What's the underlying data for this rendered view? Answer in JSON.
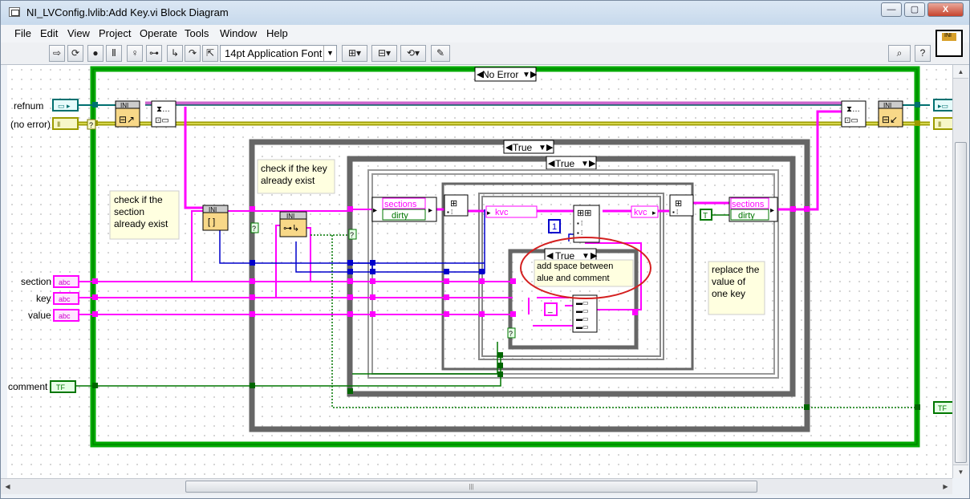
{
  "window": {
    "title": "NI_LVConfig.lvlib:Add Key.vi Block Diagram",
    "controls": {
      "minimize": "—",
      "maximize": "▢",
      "close": "X"
    }
  },
  "menubar": {
    "items": [
      "File",
      "Edit",
      "View",
      "Project",
      "Operate",
      "Tools",
      "Window",
      "Help"
    ]
  },
  "toolbar": {
    "font_select": "14pt Application Font",
    "buttons": [
      "run-arrow-icon",
      "run-continuously-icon",
      "abort-icon",
      "pause-icon",
      "highlight-execution-icon",
      "retain-wire-values-icon",
      "step-into-icon",
      "step-over-icon",
      "step-out-icon",
      "align-objects-icon",
      "distribute-objects-icon",
      "reorder-icon",
      "cleanup-diagram-icon",
      "search-icon",
      "help-icon"
    ]
  },
  "diagram": {
    "case_selectors": {
      "outer": "No Error",
      "middle": "True",
      "inner": "True",
      "innermost": "True"
    },
    "terminals": {
      "refnum": "refnum",
      "error_in": "(no error)",
      "section": "section",
      "key": "key",
      "value": "value",
      "comment": "comment",
      "string_type": "abc",
      "bool_type": "TF",
      "cluster_type": "Ⅱ"
    },
    "node_labels": {
      "ini": "INI",
      "sections": "sections",
      "dirty": "dirty",
      "kvc": "kvc",
      "const_one": "1",
      "const_true": "T"
    },
    "comments": {
      "check_section": "check if the section already exist",
      "check_key": "check if the key already exist",
      "add_space": "add space  between value and comment",
      "replace_value": "replace the value of one key"
    }
  },
  "colors": {
    "string_wire": "#ff00ff",
    "error_wire": "#a8a800",
    "refnum_wire": "#007070",
    "numeric_wire": "#0000ff",
    "bool_wire": "#006600",
    "case_frame_green": "#00aa00",
    "highlight_circle": "#d42020"
  }
}
